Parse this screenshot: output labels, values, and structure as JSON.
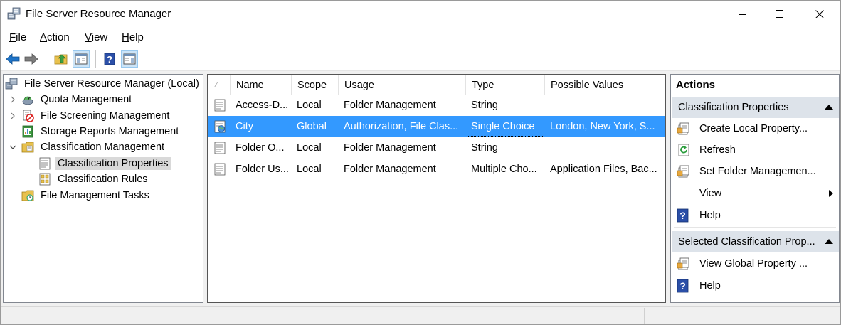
{
  "window": {
    "title": "File Server Resource Manager"
  },
  "menu": {
    "items": [
      {
        "label": "File",
        "accel": "F",
        "rest": "ile"
      },
      {
        "label": "Action",
        "accel": "A",
        "rest": "ction"
      },
      {
        "label": "View",
        "accel": "V",
        "rest": "iew"
      },
      {
        "label": "Help",
        "accel": "H",
        "rest": "elp"
      }
    ]
  },
  "toolbar": {
    "buttons": [
      "back-arrow-icon",
      "forward-arrow-icon",
      "up-folder-icon",
      "show-hide-tree-icon",
      "help-icon",
      "show-hide-action-pane-icon"
    ]
  },
  "tree": {
    "root": "File Server Resource Manager (Local)",
    "items": [
      {
        "label": "Quota Management",
        "expander": "collapsed"
      },
      {
        "label": "File Screening Management",
        "expander": "collapsed"
      },
      {
        "label": "Storage Reports Management",
        "expander": "none"
      },
      {
        "label": "Classification Management",
        "expander": "expanded"
      },
      {
        "label": "Classification Properties",
        "expander": "none",
        "selected": true
      },
      {
        "label": "Classification Rules",
        "expander": "none"
      },
      {
        "label": "File Management Tasks",
        "expander": "none"
      }
    ]
  },
  "list": {
    "columns": [
      "",
      "Name",
      "Scope",
      "Usage",
      "Type",
      "Possible Values"
    ],
    "rows": [
      {
        "name": "Access-D...",
        "scope": "Local",
        "usage": "Folder Management",
        "type": "String",
        "values": "",
        "selected": false
      },
      {
        "name": "City",
        "scope": "Global",
        "usage": "Authorization, File Clas...",
        "type": "Single Choice",
        "values": "London, New York, S...",
        "selected": true
      },
      {
        "name": "Folder O...",
        "scope": "Local",
        "usage": "Folder Management",
        "type": "String",
        "values": "",
        "selected": false
      },
      {
        "name": "Folder Us...",
        "scope": "Local",
        "usage": "Folder Management",
        "type": "Multiple Cho...",
        "values": "Application Files, Bac...",
        "selected": false
      }
    ]
  },
  "actions": {
    "title": "Actions",
    "section1": {
      "title": "Classification Properties",
      "items": [
        {
          "label": "Create Local Property...",
          "icon": "create-property-icon"
        },
        {
          "label": "Refresh",
          "icon": "refresh-icon"
        },
        {
          "label": "Set Folder Managemen...",
          "icon": "set-folder-management-icon"
        },
        {
          "label": "View",
          "icon": "none",
          "submenu": true
        },
        {
          "label": "Help",
          "icon": "help-icon"
        }
      ]
    },
    "section2": {
      "title": "Selected Classification Prop...",
      "items": [
        {
          "label": "View Global Property ...",
          "icon": "view-global-property-icon"
        },
        {
          "label": "Help",
          "icon": "help-icon"
        }
      ]
    }
  },
  "colors": {
    "selection": "#3399ff",
    "section_header": "#dde3ea",
    "tree_selected": "#d9d9d9"
  }
}
